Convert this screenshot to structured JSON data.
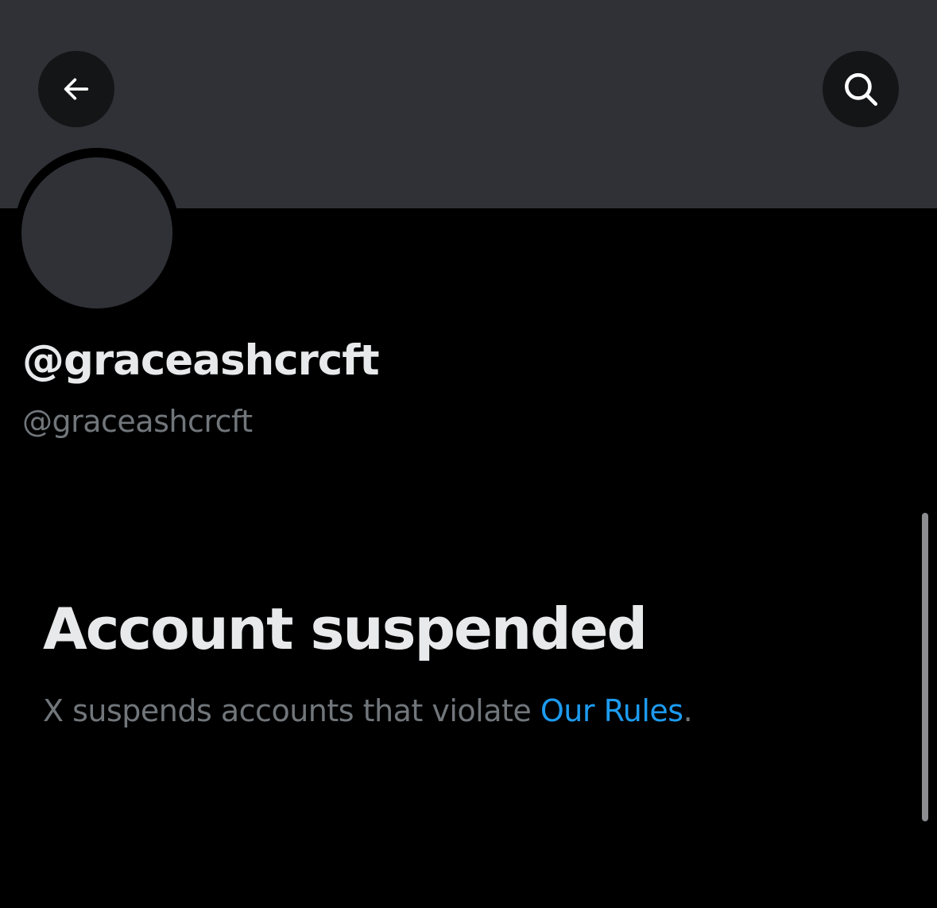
{
  "header": {
    "back_icon": "arrow-left-icon",
    "search_icon": "search-icon"
  },
  "profile": {
    "display_name": "@graceashcrcft",
    "handle": "@graceashcrcft"
  },
  "suspension": {
    "title": "Account suspended",
    "description_prefix": "X suspends accounts that violate ",
    "rules_link_label": "Our Rules",
    "description_suffix": "."
  },
  "colors": {
    "background": "#000000",
    "banner": "#2f3136",
    "primary_text": "#e7e9ea",
    "secondary_text": "#71767b",
    "link": "#1d9bf0"
  }
}
